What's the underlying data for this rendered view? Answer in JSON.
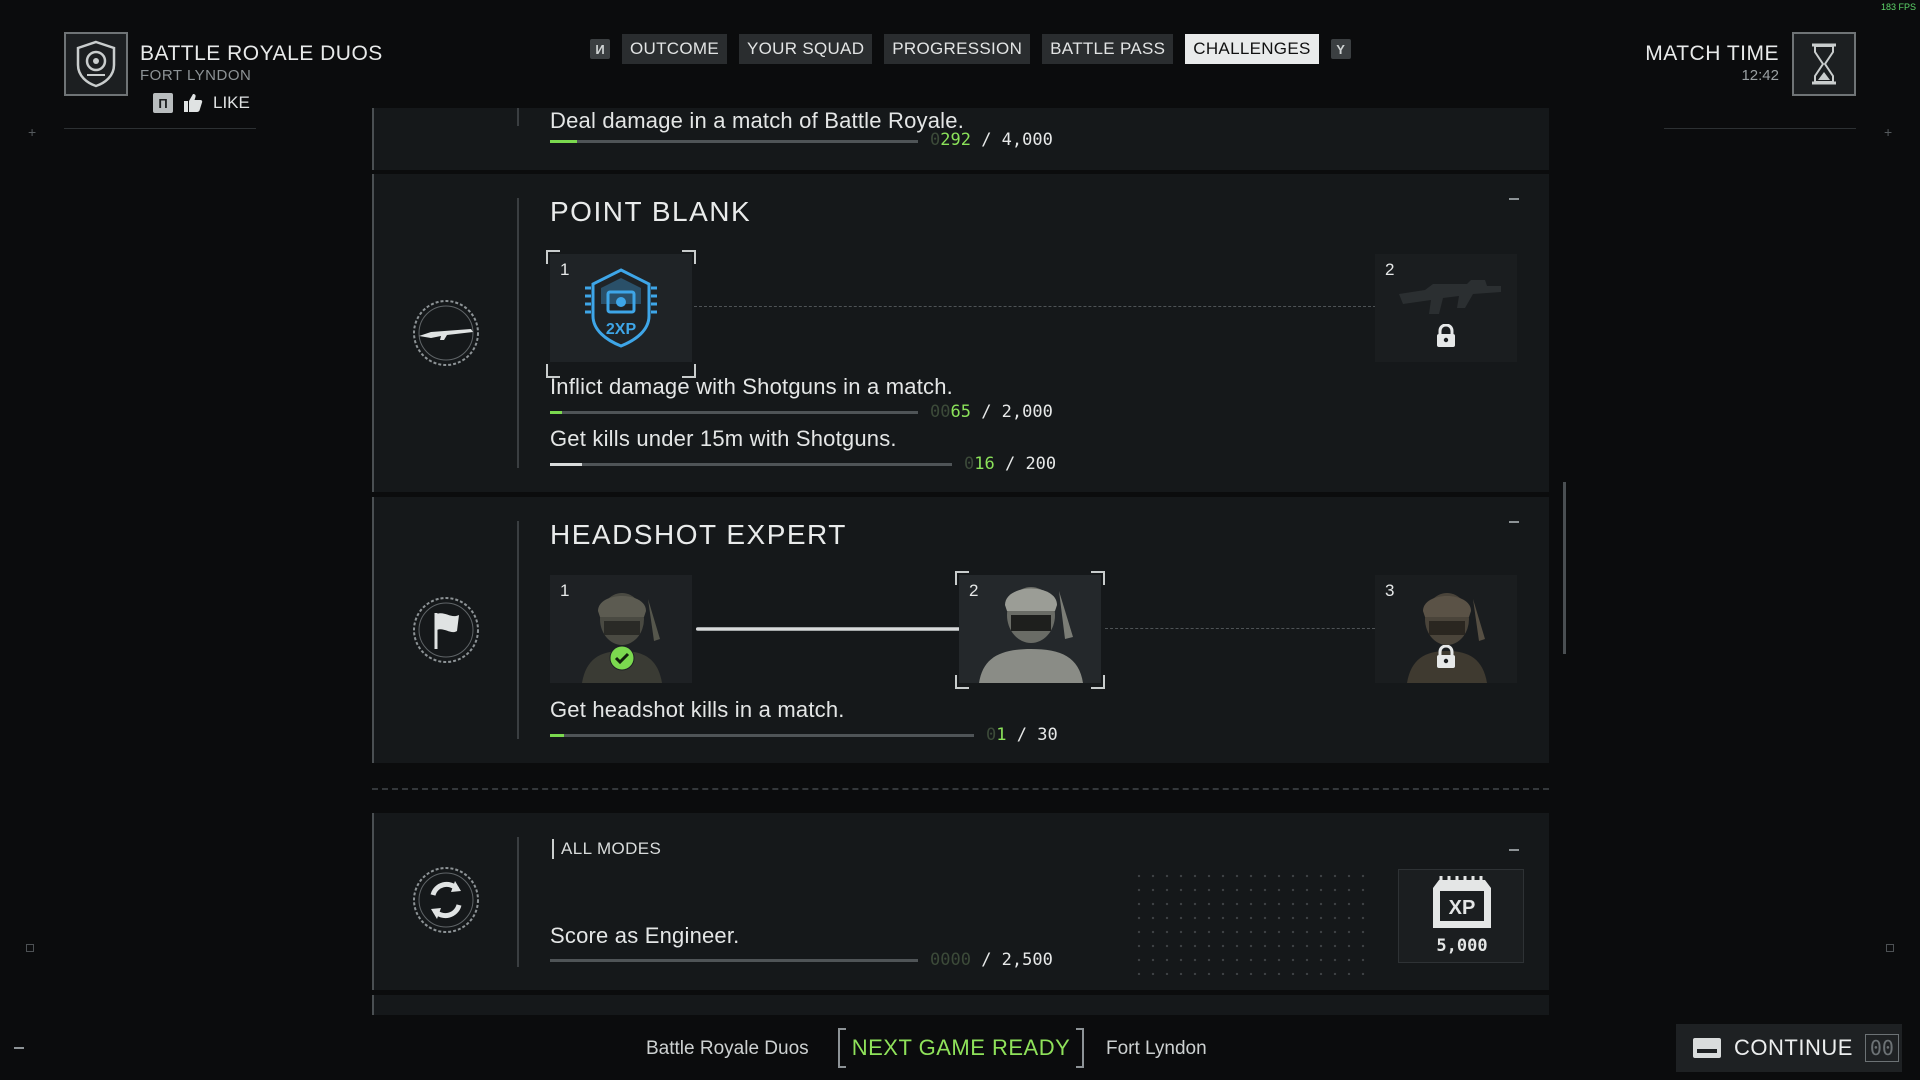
{
  "header": {
    "mode_title": "BATTLE ROYALE DUOS",
    "map_name": "FORT LYNDON",
    "like_key": "П",
    "like_label": "LIKE"
  },
  "tabs": {
    "left_key": "И",
    "right_key": "Y",
    "items": [
      {
        "label": "OUTCOME"
      },
      {
        "label": "YOUR SQUAD"
      },
      {
        "label": "PROGRESSION"
      },
      {
        "label": "BATTLE PASS"
      },
      {
        "label": "CHALLENGES",
        "active": true
      }
    ]
  },
  "match": {
    "label": "MATCH TIME",
    "time": "12:42"
  },
  "fps": "183 FPS",
  "challenges": [
    {
      "description": "Deal damage in a match of Battle Royale.",
      "progress": {
        "ghost": "0",
        "current": "292",
        "total": " / 4,000",
        "fraction": 0.073
      }
    },
    {
      "title": "POINT BLANK",
      "tiers": [
        {
          "num": "1",
          "reward_label": "2XP",
          "state": "current"
        },
        {
          "num": "2",
          "state": "locked"
        }
      ],
      "tasks": [
        {
          "description": "Inflict damage with Shotguns in a match.",
          "progress": {
            "ghost": "00",
            "current": "65",
            "total": " / 2,000",
            "fraction": 0.0325
          }
        },
        {
          "description": "Get kills under 15m with Shotguns.",
          "progress": {
            "ghost": "0",
            "current": "16",
            "total": " / 200",
            "fraction": 0.08
          }
        }
      ]
    },
    {
      "title": "HEADSHOT EXPERT",
      "tiers": [
        {
          "num": "1",
          "state": "completed"
        },
        {
          "num": "2",
          "state": "current"
        },
        {
          "num": "3",
          "state": "locked"
        }
      ],
      "tasks": [
        {
          "description": "Get headshot kills in a match.",
          "progress": {
            "ghost": "0",
            "current": "1",
            "total": " / 30",
            "fraction": 0.033
          }
        }
      ]
    },
    {
      "modes_label": "ALL MODES",
      "description": "Score as Engineer.",
      "progress": {
        "ghost": "0000",
        "current": "",
        "total": " / 2,500",
        "fraction": 0
      },
      "reward": {
        "icon_text": "XP",
        "amount": "5,000"
      }
    }
  ],
  "bottom": {
    "mode": "Battle Royale Duos",
    "status": "NEXT GAME READY",
    "map": "Fort Lyndon",
    "continue_label": "CONTINUE",
    "continue_timer": "00"
  },
  "colors": {
    "accent_green": "#8be25a",
    "active_tab_bg": "#e9ebeb"
  }
}
